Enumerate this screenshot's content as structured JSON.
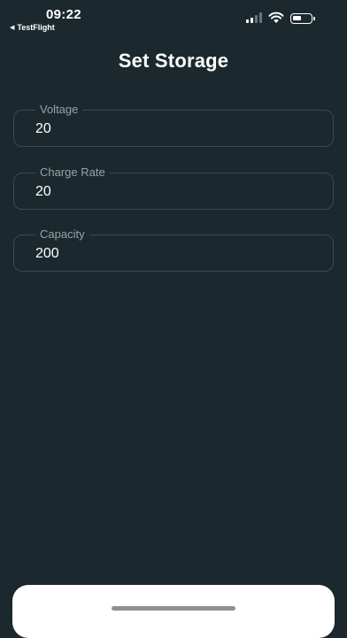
{
  "status_bar": {
    "time": "09:22",
    "back_app": "TestFlight",
    "signal_icon": "cellular-signal-icon",
    "wifi_icon": "wifi-icon",
    "battery_icon": "battery-icon",
    "battery_level": 0.5
  },
  "page": {
    "title": "Set Storage"
  },
  "fields": [
    {
      "label": "Voltage",
      "value": "20"
    },
    {
      "label": "Charge Rate",
      "value": "20"
    },
    {
      "label": "Capacity",
      "value": "200"
    }
  ],
  "colors": {
    "background": "#1b292e",
    "field_border": "#394a4e",
    "label_text": "#98a2a5",
    "text": "#ffffff"
  }
}
